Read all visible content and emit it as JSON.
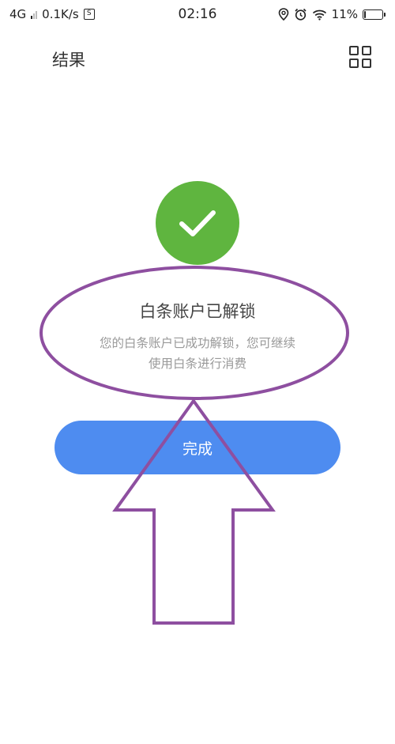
{
  "status_bar": {
    "network": "4G",
    "speed": "0.1K/s",
    "sim_badge": "S",
    "time": "02:16",
    "battery": "11%",
    "battery_level": 0.11,
    "icons": [
      "signal-icon",
      "sim-icon",
      "location-icon",
      "alarm-icon",
      "wifi-icon",
      "battery-icon"
    ]
  },
  "header": {
    "title": "结果",
    "right_icon": "grid-icon"
  },
  "result": {
    "icon": "check-icon",
    "icon_color": "#5fb53f",
    "title": "白条账户已解锁",
    "description_line1": "您的白条账户已成功解锁，您可继续",
    "description_line2": "使用白条进行消费"
  },
  "actions": {
    "done_label": "完成",
    "done_color": "#4e8cf0"
  },
  "annotation": {
    "color": "#8e4fa0",
    "shapes": [
      "ellipse",
      "arrow"
    ]
  }
}
